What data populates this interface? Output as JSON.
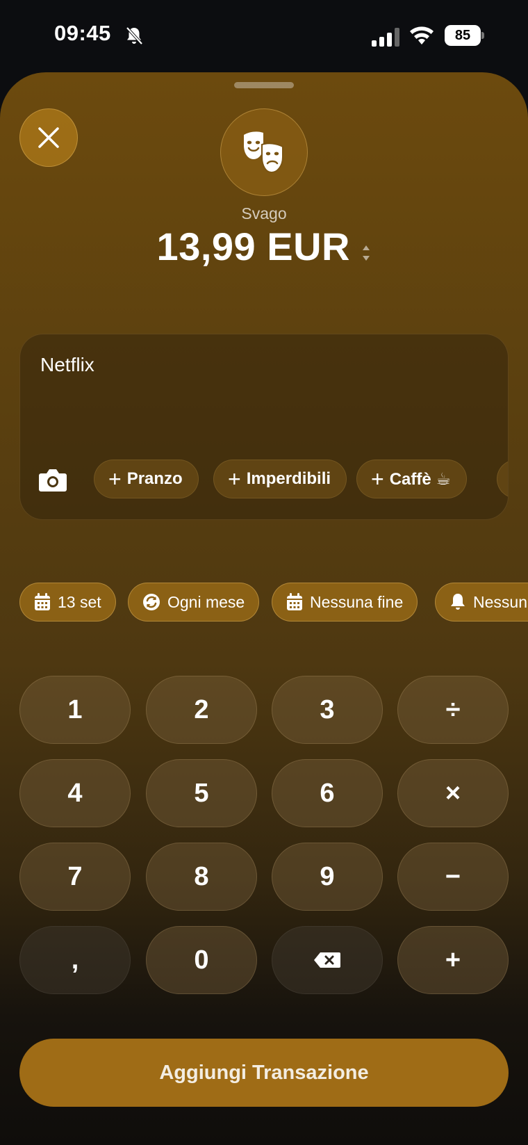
{
  "status_bar": {
    "time": "09:45",
    "battery": "85",
    "icons": [
      "bell-slash-icon",
      "cellular-signal-icon",
      "wifi-icon",
      "battery-icon"
    ]
  },
  "header": {
    "close_icon": "close-icon",
    "category_icon": "theater-masks-icon",
    "category": "Svago",
    "amount": "13,99 EUR"
  },
  "note": {
    "value": "Netflix",
    "camera_icon": "camera-icon",
    "chips": [
      {
        "label": "Pranzo"
      },
      {
        "label": "Imperdibili"
      },
      {
        "label": "Caffè ☕"
      }
    ]
  },
  "options": [
    {
      "label": "13 set",
      "icon": "calendar-icon"
    },
    {
      "label": "Ogni mese",
      "icon": "repeat-icon"
    },
    {
      "label": "Nessuna fine",
      "icon": "calendar-icon"
    },
    {
      "label": "Nessun",
      "icon": "bell-icon"
    }
  ],
  "keypad": {
    "keys": [
      "1",
      "2",
      "3",
      "÷",
      "4",
      "5",
      "6",
      "×",
      "7",
      "8",
      "9",
      "−",
      ",",
      "0",
      "backspace",
      "+"
    ]
  },
  "submit_label": "Aggiungi Transazione",
  "colors": {
    "accent": "#9f6c16",
    "sheet_top": "#6c4a0e",
    "background": "#0c0d10"
  }
}
